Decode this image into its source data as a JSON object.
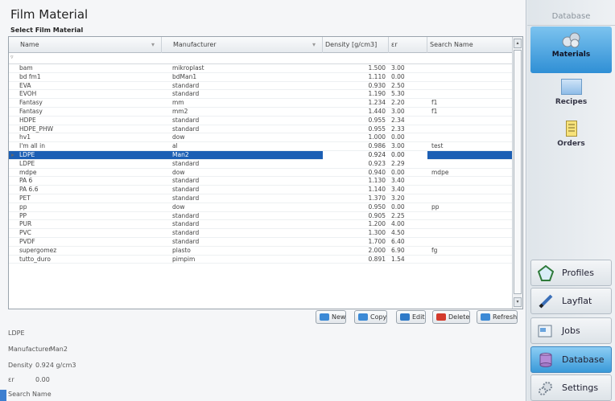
{
  "title": "Film Material",
  "subtitle": "Select Film Material",
  "columns": {
    "name": "Name",
    "manufacturer": "Manufacturer",
    "density": "Density [g/cm3]",
    "er": "εr",
    "search_name": "Search Name"
  },
  "rows": [
    {
      "name": "bam",
      "manufacturer": "mikroplast",
      "density": "1.500",
      "er": "3.00",
      "search": ""
    },
    {
      "name": "bd fm1",
      "manufacturer": "bdMan1",
      "density": "1.110",
      "er": "0.00",
      "search": ""
    },
    {
      "name": "EVA",
      "manufacturer": "standard",
      "density": "0.930",
      "er": "2.50",
      "search": ""
    },
    {
      "name": "EVOH",
      "manufacturer": "standard",
      "density": "1.190",
      "er": "5.30",
      "search": ""
    },
    {
      "name": "Fantasy",
      "manufacturer": "mm",
      "density": "1.234",
      "er": "2.20",
      "search": "f1"
    },
    {
      "name": "Fantasy",
      "manufacturer": "mm2",
      "density": "1.440",
      "er": "3.00",
      "search": "f1"
    },
    {
      "name": "HDPE",
      "manufacturer": "standard",
      "density": "0.955",
      "er": "2.34",
      "search": ""
    },
    {
      "name": "HDPE_PHW",
      "manufacturer": "standard",
      "density": "0.955",
      "er": "2.33",
      "search": ""
    },
    {
      "name": "hv1",
      "manufacturer": "dow",
      "density": "1.000",
      "er": "0.00",
      "search": ""
    },
    {
      "name": "I'm all in",
      "manufacturer": "al",
      "density": "0.986",
      "er": "3.00",
      "search": "test"
    },
    {
      "name": "LDPE",
      "manufacturer": "Man2",
      "density": "0.924",
      "er": "0.00",
      "search": "",
      "selected": true
    },
    {
      "name": "LDPE",
      "manufacturer": "standard",
      "density": "0.923",
      "er": "2.29",
      "search": ""
    },
    {
      "name": "mdpe",
      "manufacturer": "dow",
      "density": "0.940",
      "er": "0.00",
      "search": "mdpe"
    },
    {
      "name": "PA 6",
      "manufacturer": "standard",
      "density": "1.130",
      "er": "3.40",
      "search": ""
    },
    {
      "name": "PA 6.6",
      "manufacturer": "standard",
      "density": "1.140",
      "er": "3.40",
      "search": ""
    },
    {
      "name": "PET",
      "manufacturer": "standard",
      "density": "1.370",
      "er": "3.20",
      "search": ""
    },
    {
      "name": "pp",
      "manufacturer": "dow",
      "density": "0.950",
      "er": "0.00",
      "search": "pp"
    },
    {
      "name": "PP",
      "manufacturer": "standard",
      "density": "0.905",
      "er": "2.25",
      "search": ""
    },
    {
      "name": "PUR",
      "manufacturer": "standard",
      "density": "1.200",
      "er": "4.00",
      "search": ""
    },
    {
      "name": "PVC",
      "manufacturer": "standard",
      "density": "1.300",
      "er": "4.50",
      "search": ""
    },
    {
      "name": "PVDF",
      "manufacturer": "standard",
      "density": "1.700",
      "er": "6.40",
      "search": ""
    },
    {
      "name": "supergomez",
      "manufacturer": "plasto",
      "density": "2.000",
      "er": "6.90",
      "search": "fg"
    },
    {
      "name": "tutto_duro",
      "manufacturer": "pimpim",
      "density": "0.891",
      "er": "1.54",
      "search": ""
    }
  ],
  "actions": {
    "new": "New",
    "copy": "Copy",
    "edit": "Edit",
    "delete": "Delete",
    "refresh": "Refresh"
  },
  "details": {
    "name": "LDPE",
    "manufacturer_label": "Manufacturer",
    "manufacturer": "Man2",
    "density_label": "Density",
    "density": "0.924 g/cm3",
    "er_label": "εr",
    "er": "0.00",
    "search_label": "Search Name"
  },
  "side": {
    "header": "Database",
    "materials": "Materials",
    "recipes": "Recipes",
    "orders": "Orders",
    "profiles": "Profiles",
    "layflat": "Layflat",
    "jobs": "Jobs",
    "database": "Database",
    "settings": "Settings"
  },
  "colors": {
    "selection": "#1c5fb4",
    "nav_active": "#3a9ad9"
  }
}
